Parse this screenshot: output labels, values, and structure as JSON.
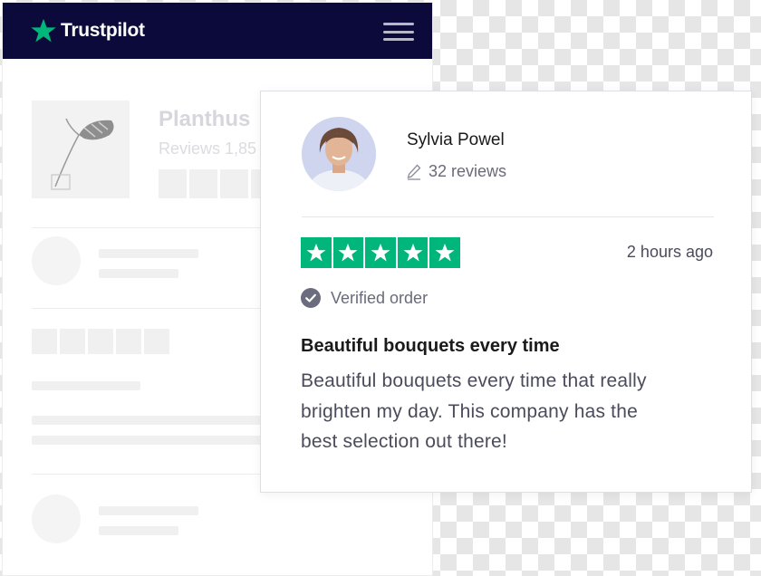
{
  "background_page": {
    "brand": "Trustpilot",
    "company_name": "Planthus",
    "company_reviews": "Reviews 1,85",
    "brand_color": "#00b67a",
    "header_color": "#0b0a3a"
  },
  "review_card": {
    "reviewer": {
      "name": "Sylvia Powel",
      "review_count": "32 reviews"
    },
    "rating": {
      "stars": 5,
      "max": 5,
      "color": "#00b67a"
    },
    "timestamp": "2 hours ago",
    "verified_label": "Verified order",
    "title": "Beautiful bouquets every time",
    "body_lines": [
      "Beautiful bouquets every time that really",
      "brighten my day. This company has the",
      "best selection out there!"
    ]
  },
  "icons": [
    "trustpilot-star-icon",
    "menu-icon",
    "pencil-icon",
    "verified-check-icon",
    "star-icon"
  ]
}
